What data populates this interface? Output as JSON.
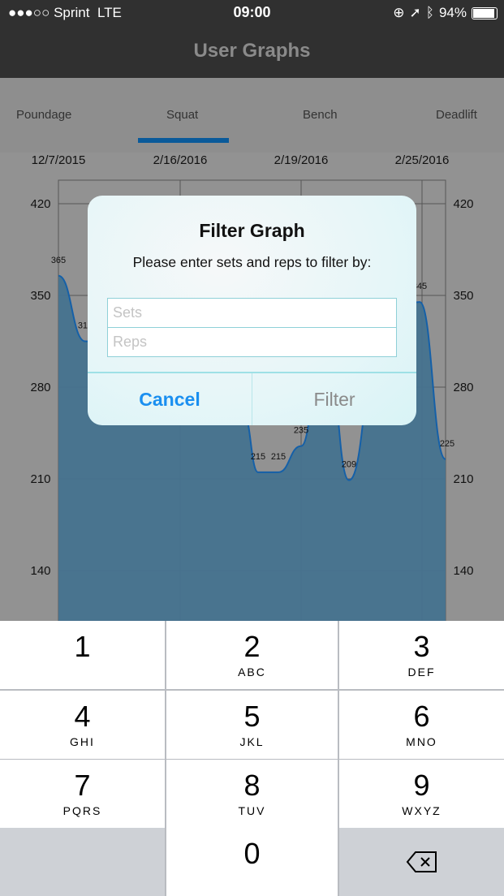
{
  "status": {
    "signal": "●●●○○",
    "carrier": "Sprint",
    "network": "LTE",
    "time": "09:00",
    "battery": "94%",
    "icons": [
      "orientation-lock-icon",
      "location-arrow-icon",
      "bluetooth-icon",
      "battery-icon"
    ]
  },
  "nav": {
    "title": "User Graphs"
  },
  "tabs": [
    {
      "label": "Poundage"
    },
    {
      "label": "Squat",
      "selected": true
    },
    {
      "label": "Bench"
    },
    {
      "label": "Deadlift"
    }
  ],
  "colors": {
    "accent": "#0a5a9a",
    "fill": "#46738f",
    "line": "#1560a8",
    "cancel": "#1a8ff0"
  },
  "chart_data": {
    "type": "area",
    "x_ticks": [
      "12/7/2015",
      "2/16/2016",
      "2/19/2016",
      "2/25/2016"
    ],
    "y_ticks": [
      420,
      350,
      280,
      210,
      140
    ],
    "ylim": [
      90,
      470
    ],
    "grid": true,
    "points": [
      {
        "label": "365",
        "value": 365
      },
      {
        "label": "315",
        "value": 315
      },
      {
        "label": "215",
        "value": 215
      },
      {
        "label": "215",
        "value": 215
      },
      {
        "label": "235",
        "value": 235
      },
      {
        "label": "209",
        "value": 209
      },
      {
        "label": "345",
        "value": 345
      },
      {
        "label": "225",
        "value": 225
      }
    ]
  },
  "dialog": {
    "title": "Filter Graph",
    "message": "Please enter sets and reps to filter by:",
    "sets_placeholder": "Sets",
    "reps_placeholder": "Reps",
    "cancel": "Cancel",
    "filter": "Filter"
  },
  "keyboard": [
    {
      "n": "1",
      "s": ""
    },
    {
      "n": "2",
      "s": "ABC"
    },
    {
      "n": "3",
      "s": "DEF"
    },
    {
      "n": "4",
      "s": "GHI"
    },
    {
      "n": "5",
      "s": "JKL"
    },
    {
      "n": "6",
      "s": "MNO"
    },
    {
      "n": "7",
      "s": "PQRS"
    },
    {
      "n": "8",
      "s": "TUV"
    },
    {
      "n": "9",
      "s": "WXYZ"
    },
    {
      "n": "0",
      "s": ""
    }
  ]
}
